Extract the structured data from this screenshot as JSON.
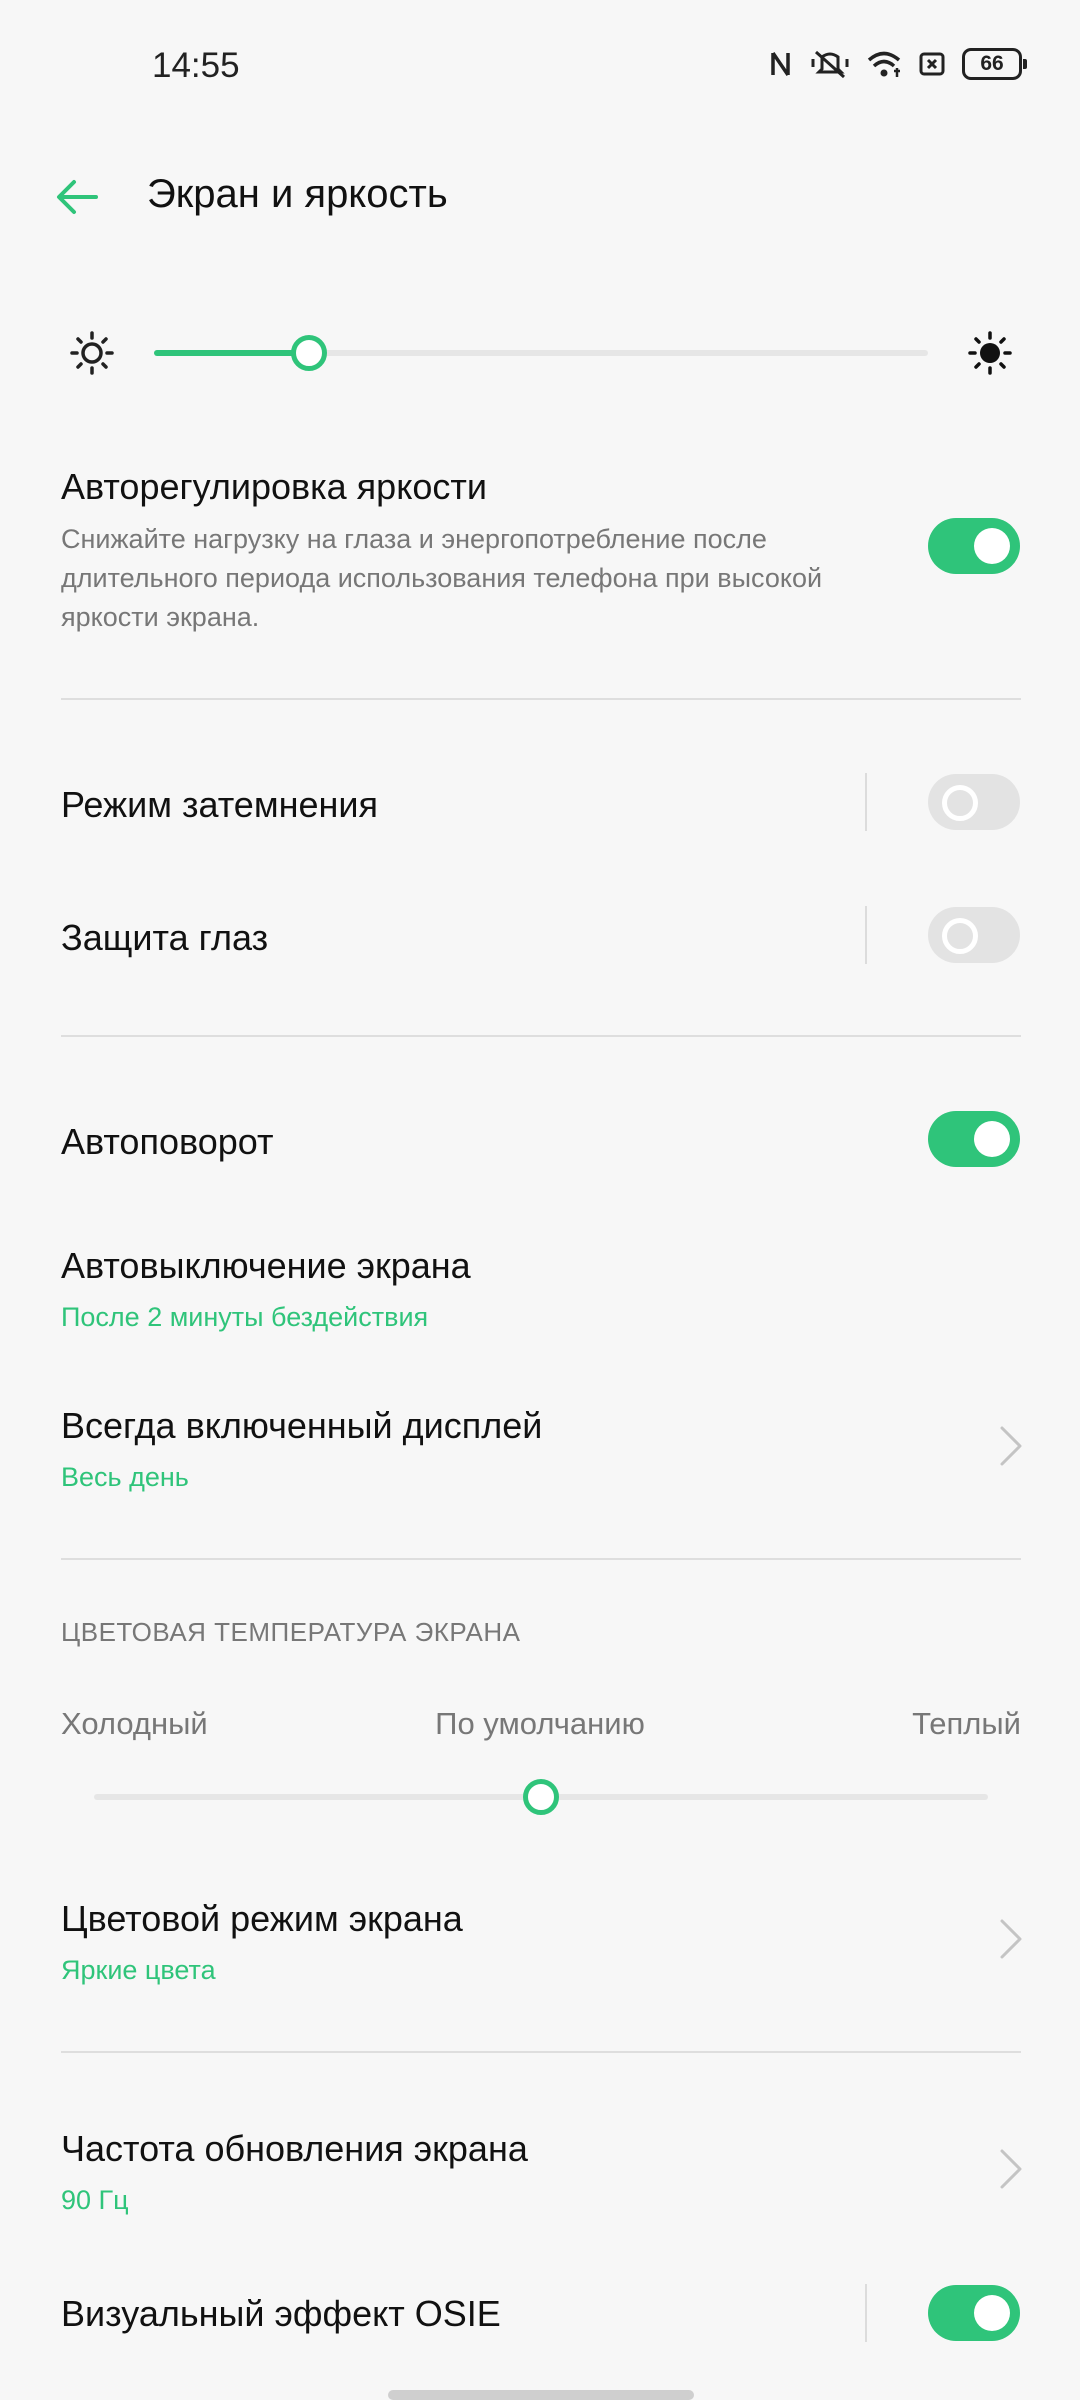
{
  "status_bar": {
    "time": "14:55",
    "battery": "66",
    "icons": [
      "nfc-icon",
      "silent-icon",
      "wifi-icon",
      "sim-icon",
      "battery-icon"
    ]
  },
  "header": {
    "title": "Экран и яркость",
    "back_icon": "arrow-left-icon"
  },
  "brightness": {
    "level": 0.2,
    "min_icon": "sun-outline-icon",
    "max_icon": "sun-filled-icon"
  },
  "auto_brightness": {
    "label": "Авторегулировка яркости",
    "description": "Снижайте нагрузку на глаза и энергопотребление после длительного периода использования телефона при высокой яркости экрана.",
    "enabled": true
  },
  "dark_mode": {
    "label": "Режим затемнения",
    "enabled": false
  },
  "eye_protection": {
    "label": "Защита глаз",
    "enabled": false
  },
  "auto_rotate": {
    "label": "Автоповорот",
    "enabled": true
  },
  "screen_timeout": {
    "label": "Автовыключение экрана",
    "value": "После 2 минуты бездействия"
  },
  "always_on": {
    "label": "Всегда включенный дисплей",
    "value": "Весь день"
  },
  "color_temp": {
    "section_title": "ЦВЕТОВАЯ ТЕМПЕРАТУРА ЭКРАНА",
    "cold": "Холодный",
    "default": "По умолчанию",
    "warm": "Теплый",
    "level": 0.5
  },
  "color_mode": {
    "label": "Цветовой режим экрана",
    "value": "Яркие цвета"
  },
  "refresh_rate": {
    "label": "Частота обновления экрана",
    "value": "90 Гц"
  },
  "osie": {
    "label": "Визуальный эффект OSIE",
    "enabled": true
  },
  "colors": {
    "accent": "#2fc47a",
    "background": "#f7f7f7"
  }
}
